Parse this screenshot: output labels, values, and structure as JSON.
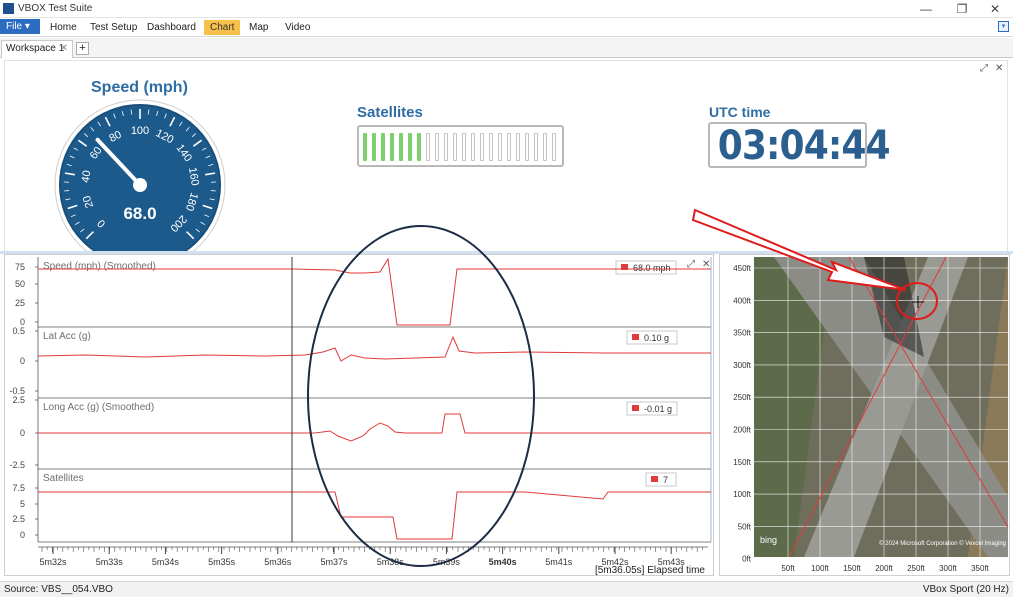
{
  "window": {
    "title": "VBOX Test Suite",
    "minimize": "—",
    "restore": "❐",
    "close": "✕"
  },
  "menu": {
    "file": "File ▾",
    "items": [
      {
        "label": "Home"
      },
      {
        "label": "Test Setup"
      },
      {
        "label": "Dashboard"
      },
      {
        "label": "Chart",
        "active": true
      },
      {
        "label": "Map"
      },
      {
        "label": "Video"
      }
    ],
    "ribbon_toggle": "▾"
  },
  "workspace_tab": {
    "label": "Workspace 1",
    "close": "✕",
    "add": "+"
  },
  "top_panel": {
    "expand": "⤢",
    "close": "✕"
  },
  "speed_gauge": {
    "title": "Speed (mph)",
    "value": 68.0,
    "value_text": "68.0",
    "min": 0,
    "max": 200,
    "ticks": [
      "0",
      "20",
      "40",
      "60",
      "80",
      "100",
      "120",
      "140",
      "160",
      "180",
      "200"
    ],
    "face_color": "#1d5a8c"
  },
  "satellites": {
    "title": "Satellites",
    "lit": 7,
    "total": 22,
    "lit_color": "#7ccf6a",
    "unlit_color": "#ffffff"
  },
  "utc": {
    "title": "UTC time",
    "value": "03:04:44"
  },
  "chart_panel": {
    "expand": "⤢",
    "close": "✕",
    "time_ticks": [
      "5m32s",
      "5m33s",
      "5m34s",
      "5m35s",
      "5m36s",
      "5m37s",
      "5m38s",
      "5m39s",
      "5m40s",
      "5m41s",
      "5m42s",
      "5m43s"
    ],
    "cursor_time": "[5m36.05s] Elapsed time",
    "line_color": "#e03a3a"
  },
  "chart_data": [
    {
      "type": "line",
      "title": "Speed (mph) (Smoothed)",
      "legend_value": "68.0 mph",
      "y_ticks": [
        "75",
        "50",
        "25",
        "0"
      ],
      "ylim": [
        0,
        90
      ],
      "x": [
        5.32,
        5.36,
        5.375,
        5.378,
        5.38,
        5.382,
        5.385,
        5.39,
        5.39,
        5.394,
        5.398,
        5.4,
        5.435
      ],
      "x_unit": "min.sec",
      "values": [
        68,
        68,
        68,
        66,
        64,
        63,
        68,
        5,
        5,
        5,
        68,
        68,
        68
      ]
    },
    {
      "type": "line",
      "title": "Lat Acc (g)",
      "legend_value": "0.10 g",
      "y_ticks": [
        "0.5",
        "0",
        "-0.5"
      ],
      "ylim": [
        -0.6,
        0.6
      ],
      "values": [
        0.1,
        0.1,
        0.15,
        0.05,
        0.0,
        0.25,
        0.1,
        0.1
      ]
    },
    {
      "type": "line",
      "title": "Long Acc (g) (Smoothed)",
      "legend_value": "-0.01 g",
      "y_ticks": [
        "2.5",
        "0",
        "-2.5"
      ],
      "ylim": [
        -3,
        3
      ],
      "values": [
        0,
        0,
        -0.1,
        0.3,
        -0.2,
        0.4,
        0,
        1.0,
        0,
        0
      ]
    },
    {
      "type": "line",
      "title": "Satellites",
      "legend_value": "7",
      "y_ticks": [
        "7.5",
        "5",
        "2.5",
        "0"
      ],
      "ylim": [
        0,
        9
      ],
      "values": [
        7,
        7,
        2,
        0,
        0,
        7,
        6,
        7,
        7
      ]
    }
  ],
  "map": {
    "y_ticks": [
      "450ft",
      "400ft",
      "350ft",
      "300ft",
      "250ft",
      "200ft",
      "150ft",
      "100ft",
      "50ft",
      "0ft"
    ],
    "x_ticks": [
      "50ft",
      "100ft",
      "150ft",
      "200ft",
      "250ft",
      "300ft",
      "350ft"
    ],
    "copyright": "© 2024 Microsoft Corporation  © Vexcel Imaging",
    "bing": "bing"
  },
  "status": {
    "source": "Source: VBS__054.VBO",
    "device": "VBox Sport (20 Hz)"
  }
}
